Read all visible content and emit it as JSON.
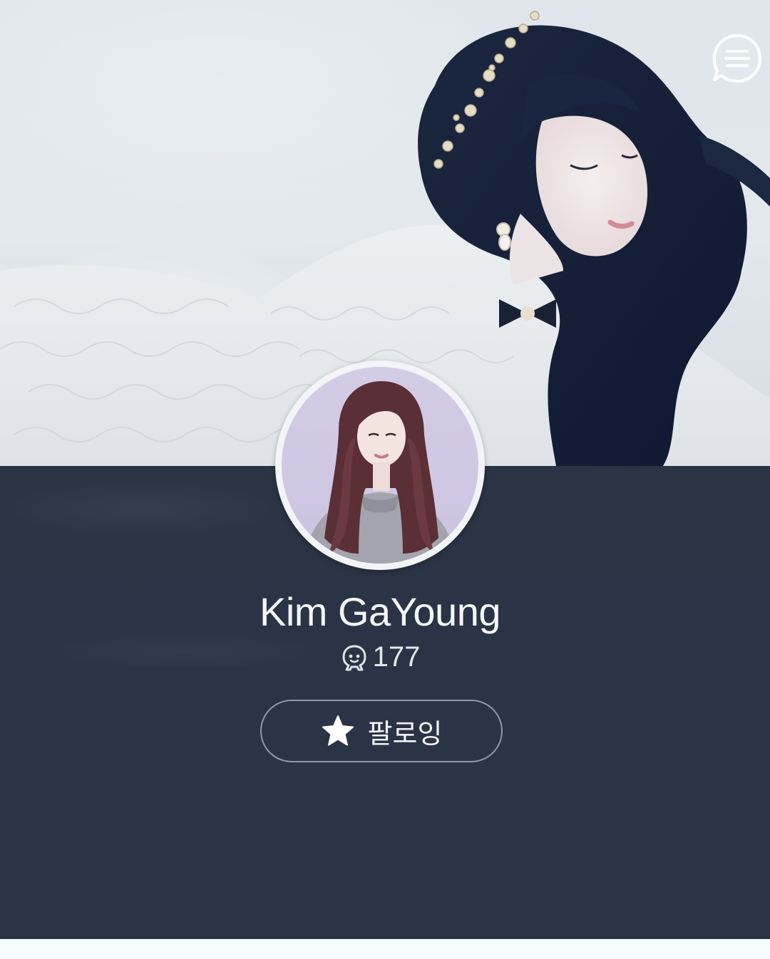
{
  "header": {
    "menu_icon": "chat-menu-icon"
  },
  "profile": {
    "name": "Kim GaYoung",
    "follower_icon": "fan-face-icon",
    "follower_count": "177",
    "follow_button": {
      "icon": "star-icon",
      "label": "팔로잉"
    }
  },
  "colors": {
    "panel": "#2b3446",
    "text": "#f4f6f8",
    "button_border": "#8e9aa6",
    "page_background": "#f4fbfd"
  }
}
